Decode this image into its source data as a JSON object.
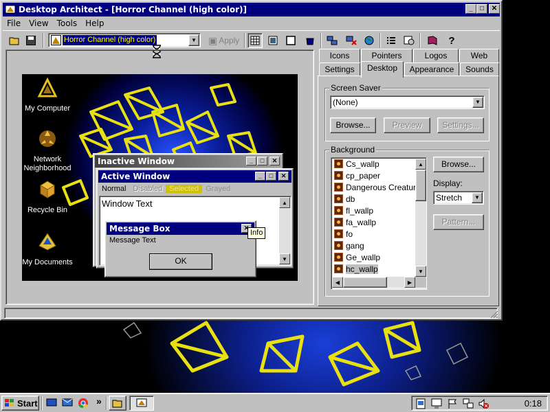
{
  "window": {
    "title": "Desktop Architect - [Horror Channel (high color)]",
    "min_glyph": "_",
    "max_glyph": "□",
    "close_glyph": "✕",
    "restore_glyph": "▫"
  },
  "menu": [
    "File",
    "View",
    "Tools",
    "Help"
  ],
  "toolbar": {
    "scheme_value": "Horror Channel (high color)",
    "apply_label": "Apply"
  },
  "preview": {
    "desktop_icons": [
      "My Computer",
      "Network Neighborhood",
      "Recycle Bin",
      "My Documents"
    ],
    "inactive_title": "Inactive Window",
    "active_title": "Active Window",
    "menu_states": [
      "Normal",
      "Disabled",
      "Selected",
      "Grayed"
    ],
    "window_text": "Window Text",
    "msgbox_title": "Message Box",
    "msgbox_text": "Message Text",
    "ok_label": "OK",
    "tooltip": "Info"
  },
  "tabs": {
    "row1": [
      "Icons",
      "Pointers",
      "Logos",
      "Web"
    ],
    "row2": [
      "Settings",
      "Desktop",
      "Appearance",
      "Sounds"
    ],
    "active": "Desktop"
  },
  "screen_saver": {
    "label": "Screen Saver",
    "value": "(None)",
    "browse": "Browse...",
    "preview": "Preview",
    "settings": "Settings..."
  },
  "background": {
    "label": "Background",
    "items": [
      "Cs_wallp",
      "cp_paper",
      "Dangerous Creatures",
      "db",
      "fl_wallp",
      "fa_wallp",
      "fo",
      "gang",
      "Ge_wallp",
      "hc_wallp"
    ],
    "selected": "hc_wallp",
    "browse": "Browse...",
    "display_label": "Display:",
    "display_value": "Stretch",
    "pattern": "Pattern..."
  },
  "taskbar": {
    "start_label": "Start",
    "clock": "0:18",
    "quick_more": "»"
  }
}
